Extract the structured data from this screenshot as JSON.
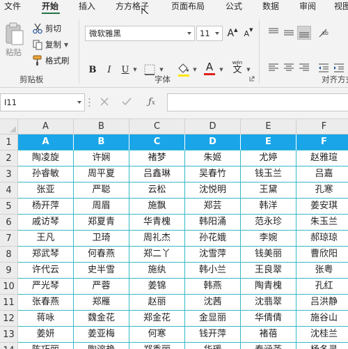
{
  "menu": {
    "tabs": [
      "文件",
      "开始",
      "插入",
      "方方格子",
      "页面布局",
      "公式",
      "数据",
      "审阅",
      "视图"
    ],
    "active": "开始"
  },
  "ribbon": {
    "clipboard": {
      "paste": "粘贴",
      "cut": "剪切",
      "copy": "复制",
      "format_painter": "格式刷",
      "group_label": "剪贴板"
    },
    "font": {
      "font_name": "微软雅黑",
      "font_size": "11",
      "grow": "A",
      "shrink": "A",
      "bold": "B",
      "italic": "I",
      "underline": "U",
      "font_color_letter": "A",
      "phonetic": "wén",
      "group_label": "字体",
      "highlight_color": "#FFE600",
      "font_color": "#E0201B"
    },
    "alignment": {
      "group_label": "对齐方式"
    }
  },
  "formula_bar": {
    "name_box": "I11",
    "formula": ""
  },
  "sheet": {
    "columns": [
      "A",
      "B",
      "C",
      "D",
      "E",
      "F"
    ],
    "rows": [
      [
        "1",
        "A",
        "B",
        "C",
        "D",
        "E",
        "F"
      ],
      [
        "2",
        "陶凌旋",
        "许娴",
        "褚梦",
        "朱姬",
        "尤婷",
        "赵雅瑄"
      ],
      [
        "3",
        "孙睿敏",
        "周平夏",
        "吕鑫琳",
        "吴春竹",
        "钱玉兰",
        "吕嘉"
      ],
      [
        "4",
        "张亚",
        "严聪",
        "云松",
        "沈悦明",
        "王黛",
        "孔寒"
      ],
      [
        "5",
        "杨开萍",
        "周眉",
        "施飘",
        "郑芸",
        "韩洋",
        "姜安琪"
      ],
      [
        "6",
        "戚访琴",
        "郑夏青",
        "华青槐",
        "韩阳涌",
        "范永珍",
        "朱玉兰"
      ],
      [
        "7",
        "王凡",
        "卫琦",
        "周礼杰",
        "孙花娥",
        "李婉",
        "郝琼琼"
      ],
      [
        "8",
        "郑武琴",
        "何春燕",
        "郑二丫",
        "沈雪萍",
        "钱美丽",
        "曹欣阳"
      ],
      [
        "9",
        "许代云",
        "史半雪",
        "施纨",
        "韩小兰",
        "王良翠",
        "张粤"
      ],
      [
        "10",
        "严光琴",
        "严蓉",
        "姜锦",
        "韩燕",
        "陶青槐",
        "孔红"
      ],
      [
        "11",
        "张春燕",
        "郑雁",
        "赵丽",
        "沈茜",
        "沈翡翠",
        "吕洪静"
      ],
      [
        "12",
        "蒋咏",
        "魏金花",
        "郑金花",
        "金显丽",
        "华倩倩",
        "施谷山"
      ],
      [
        "13",
        "姜妍",
        "姜亚梅",
        "何寒",
        "钱开萍",
        "褚蓓",
        "沈桂兰"
      ],
      [
        "14",
        "陈巧丽",
        "陶溶艳",
        "郑秀丽",
        "华瑗",
        "秦涵菡",
        "杨冬灵"
      ]
    ]
  },
  "colors": {
    "header_row_bg": "#1AA5E8",
    "grid_border": "#35B8C8",
    "accent": "#217346"
  }
}
